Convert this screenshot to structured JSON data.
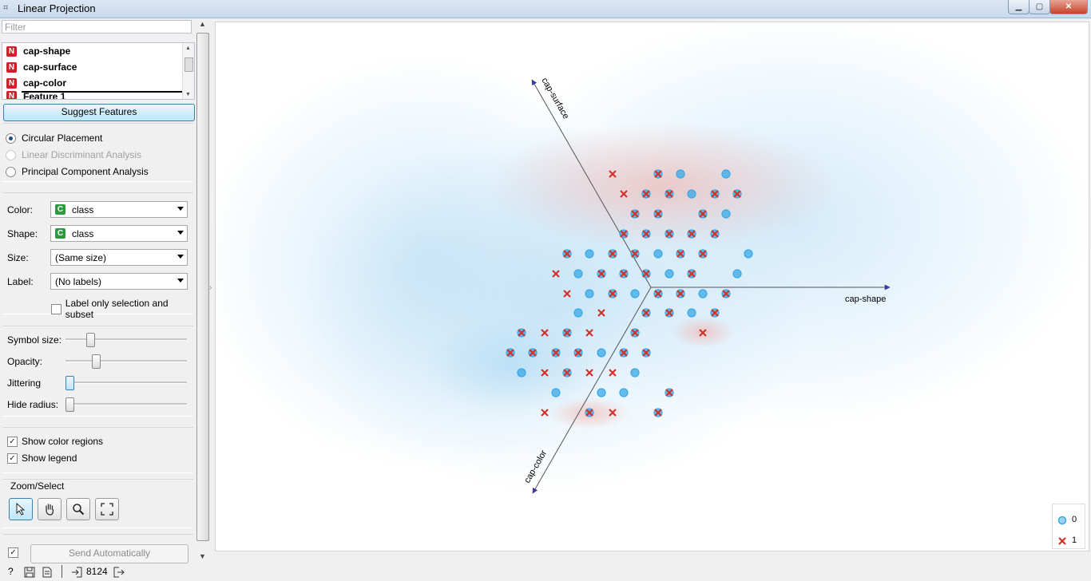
{
  "window": {
    "title": "Linear Projection"
  },
  "filter": {
    "placeholder": "Filter"
  },
  "features": [
    {
      "type": "N",
      "name": "cap-shape"
    },
    {
      "type": "N",
      "name": "cap-surface"
    },
    {
      "type": "N",
      "name": "cap-color"
    },
    {
      "type": "N",
      "name": "Feature 1"
    }
  ],
  "suggest_features_label": "Suggest Features",
  "placement": {
    "options": [
      "Circular Placement",
      "Linear Discriminant Analysis",
      "Principal Component Analysis"
    ],
    "selected": "Circular Placement",
    "disabled": [
      "Linear Discriminant Analysis"
    ]
  },
  "properties": {
    "color_label": "Color:",
    "color_value": "class",
    "color_badge": "C",
    "shape_label": "Shape:",
    "shape_value": "class",
    "shape_badge": "C",
    "size_label": "Size:",
    "size_value": "(Same size)",
    "label_label": "Label:",
    "label_value": "(No labels)",
    "label_only_selection": "Label only selection and subset"
  },
  "sliders": {
    "symbol_size": {
      "label": "Symbol size:",
      "level": 0.18
    },
    "opacity": {
      "label": "Opacity:",
      "level": 0.23
    },
    "jittering": {
      "label": "Jittering",
      "level": 0.0
    },
    "hide_radius": {
      "label": "Hide radius:",
      "level": 0.0
    }
  },
  "show": {
    "color_regions": "Show color regions",
    "color_regions_checked": true,
    "legend": "Show legend",
    "legend_checked": true
  },
  "zoom_select": {
    "title": "Zoom/Select",
    "tools": [
      "pointer-icon",
      "pan-hand-icon",
      "zoom-icon",
      "reset-zoom-icon"
    ]
  },
  "send": {
    "label": "Send Automatically",
    "checked": true
  },
  "statusbar": {
    "count": "8124"
  },
  "axes": [
    "cap-shape",
    "cap-surface",
    "cap-color"
  ],
  "legend": [
    {
      "label": "0",
      "color": "#3aa8e6"
    },
    {
      "label": "1",
      "color": "#d0322a"
    }
  ],
  "colors": {
    "class0": "#3aa8e6",
    "class1": "#d0322a",
    "accent": "#3c7fb1"
  },
  "chart_data": {
    "type": "scatter",
    "title": "",
    "axes_labels": [
      "cap-shape",
      "cap-surface",
      "cap-color"
    ],
    "series": [
      {
        "name": "0",
        "marker": "circle"
      },
      {
        "name": "1",
        "marker": "x"
      }
    ],
    "grid": false,
    "legend_position": "bottom-right"
  }
}
